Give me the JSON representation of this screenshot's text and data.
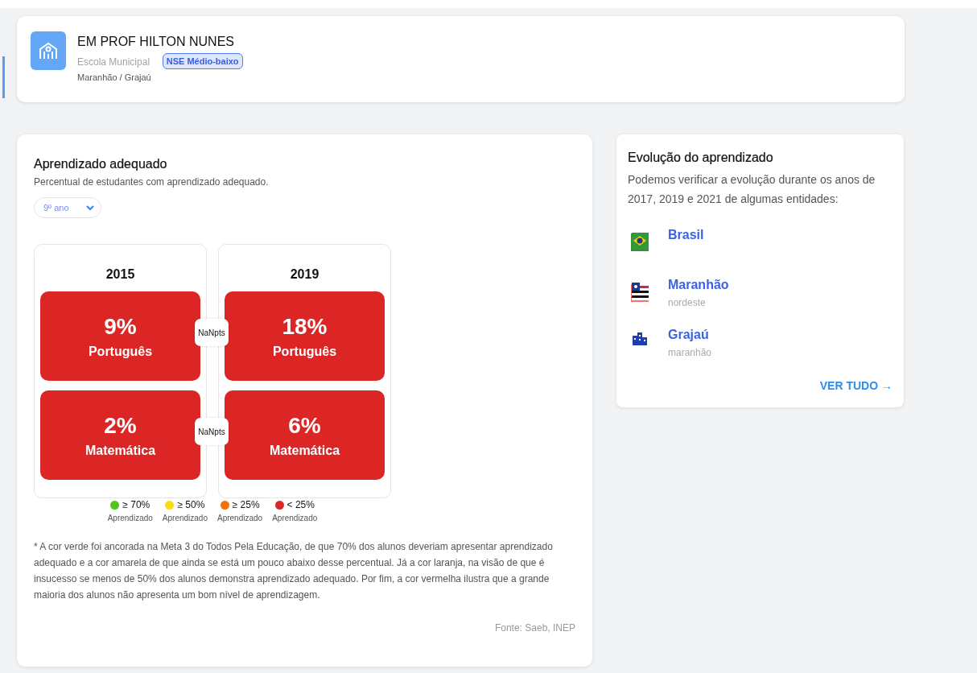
{
  "school": {
    "name": "EM PROF HILTON NUNES",
    "type": "Escola Municipal",
    "location": "Maranhão / Grajaú",
    "badge": "NSE Médio-baixo"
  },
  "learning": {
    "title": "Aprendizado adequado",
    "subtitle": "Percentual de estudantes com aprendizado adequado.",
    "grade_select": {
      "value": "9º ano"
    },
    "years": [
      {
        "year": "2015",
        "tiles": [
          {
            "value": "9%",
            "subject": "Português",
            "color": "#dc2626"
          },
          {
            "value": "2%",
            "subject": "Matemática",
            "color": "#dc2626"
          }
        ]
      },
      {
        "year": "2019",
        "tiles": [
          {
            "value": "18%",
            "subject": "Português",
            "color": "#dc2626"
          },
          {
            "value": "6%",
            "subject": "Matemática",
            "color": "#dc2626"
          }
        ]
      }
    ],
    "differences": [
      "NaNpts",
      "NaNpts"
    ],
    "legend": [
      {
        "label": "≥ 70%",
        "caption": "Aprendizado",
        "color": "#52c41a"
      },
      {
        "label": "≥ 50%",
        "caption": "Aprendizado",
        "color": "#fadb14"
      },
      {
        "label": "≥ 25%",
        "caption": "Aprendizado",
        "color": "#fa6e0a"
      },
      {
        "label": "< 25%",
        "caption": "Aprendizado",
        "color": "#dc2626"
      }
    ],
    "note": "* A cor verde foi ancorada na Meta 3 do Todos Pela Educação, de que 70% dos alunos deveriam apresentar aprendizado adequado e a cor amarela de que ainda se está um pouco abaixo desse percentual. Já a cor laranja, na visão de que é insucesso se menos de 50% dos alunos demonstra aprendizado adequado. Por fim, a cor vermelha ilustra que a grande maioria dos alunos não apresenta um bom nível de aprendizagem.",
    "source": "Fonte: Saeb, INEP"
  },
  "evolution": {
    "title": "Evolução do aprendizado",
    "description": "Podemos verificar a evolução durante os anos de 2017, 2019 e 2021 de algumas entidades:",
    "entities": [
      {
        "kind": "country",
        "name": "Brasil"
      },
      {
        "kind": "state",
        "name": "Maranhão",
        "region": "nordeste"
      },
      {
        "kind": "city",
        "name": "Grajaú",
        "region": "maranhão"
      }
    ],
    "link": "VER TUDO →"
  }
}
